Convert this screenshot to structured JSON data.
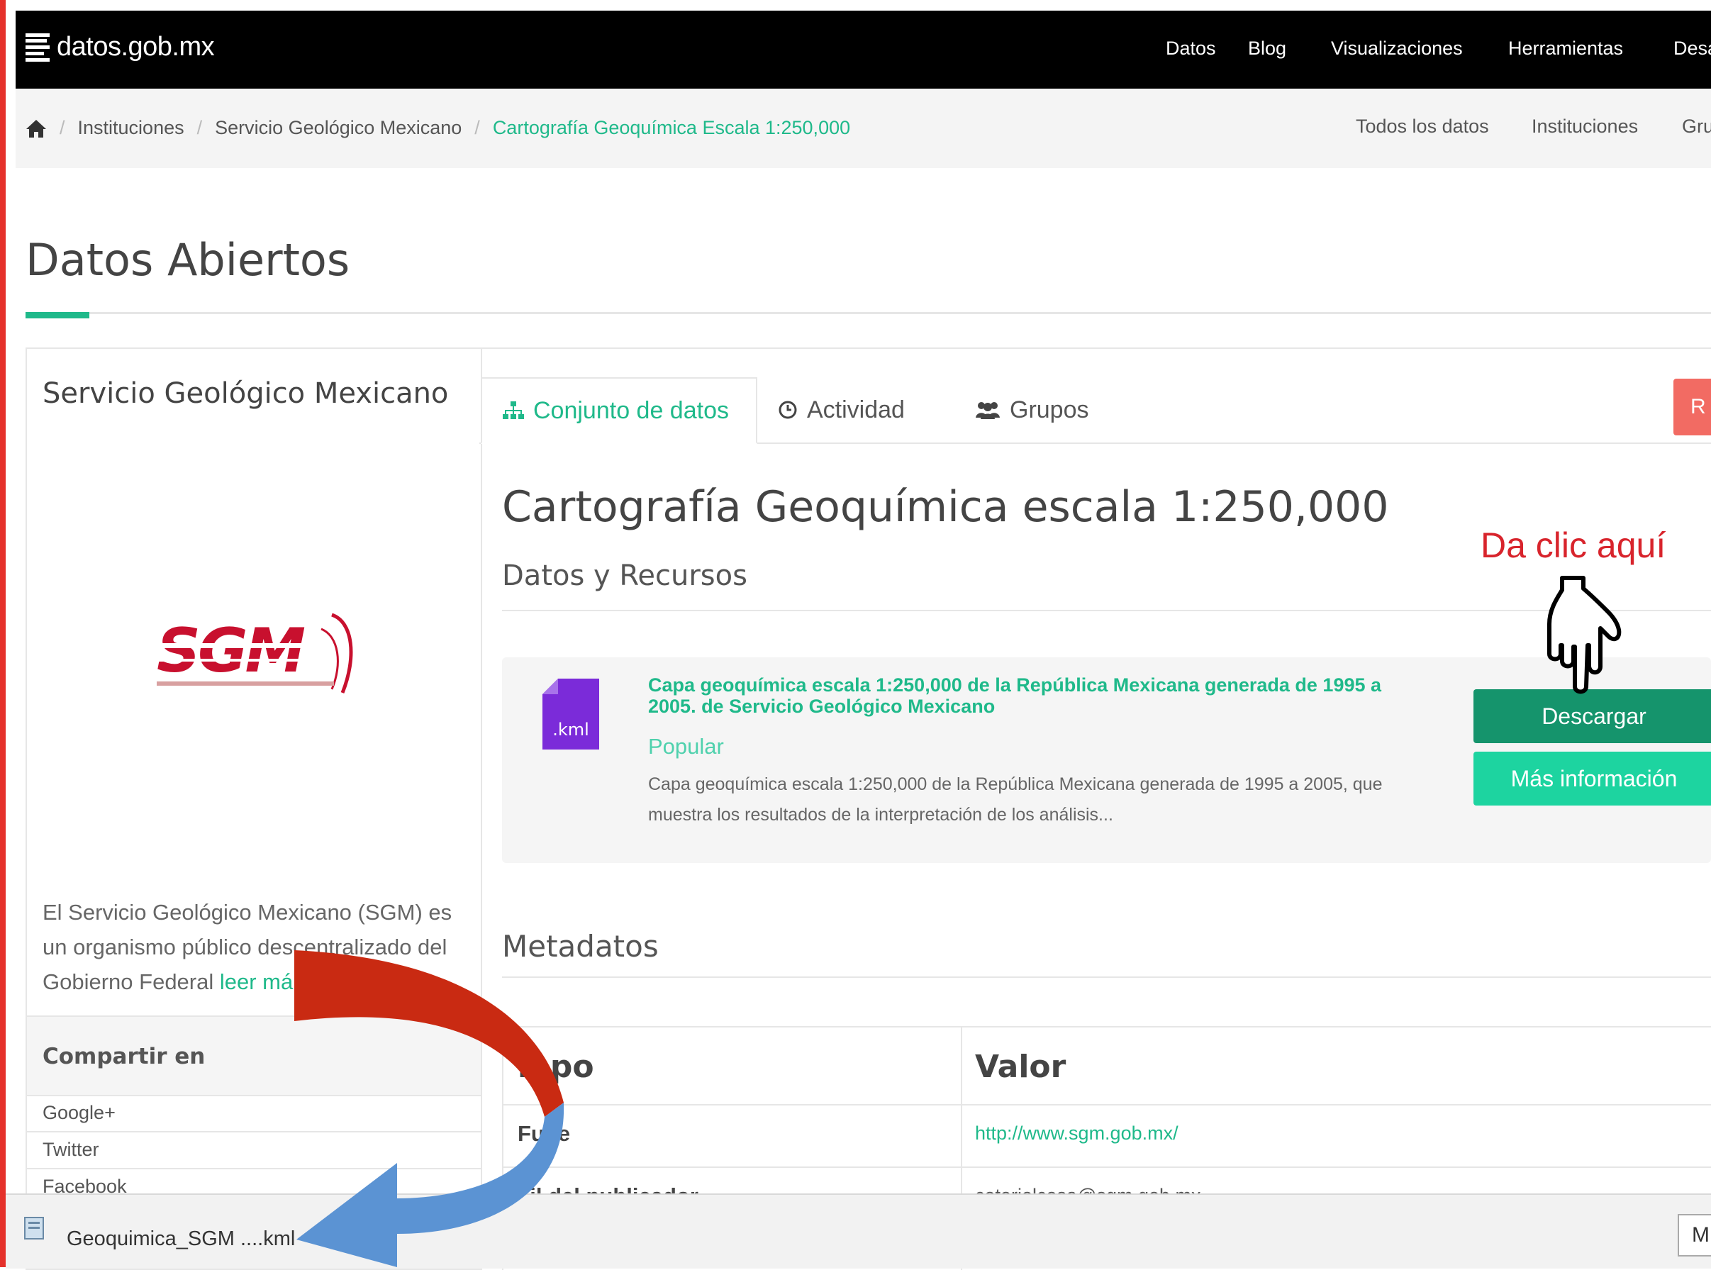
{
  "nav": {
    "brand": "datos.gob.mx",
    "links": [
      "Datos",
      "Blog",
      "Visualizaciones",
      "Herramientas",
      "Desa"
    ]
  },
  "breadcrumb": {
    "items": [
      "Instituciones",
      "Servicio Geológico Mexicano"
    ],
    "current": "Cartografía Geoquímica Escala 1:250,000",
    "sublinks": [
      "Todos los datos",
      "Instituciones",
      "Gru"
    ]
  },
  "page": {
    "title": "Datos Abiertos"
  },
  "sidebar": {
    "org_name": "Servicio Geológico Mexicano",
    "logo_text": "SGM",
    "description": "El Servicio Geológico Mexicano (SGM) es un organismo público descentralizado del Gobierno Federal",
    "read_more": "leer má",
    "share_title": "Compartir en",
    "share_items": [
      "Google+",
      "Twitter",
      "Facebook"
    ]
  },
  "tabs": [
    {
      "label": "Conjunto de datos",
      "icon": "sitemap-icon",
      "active": true
    },
    {
      "label": "Actividad",
      "icon": "clock-icon",
      "active": false
    },
    {
      "label": "Grupos",
      "icon": "users-icon",
      "active": false
    }
  ],
  "red_button": {
    "label": "R"
  },
  "dataset": {
    "title": "Cartografía Geoquímica escala 1:250,000",
    "section": "Datos y Recursos"
  },
  "resource": {
    "format": ".kml",
    "title": "Capa geoquímica escala 1:250,000 de la República Mexicana generada de 1995 a 2005. de Servicio Geológico Mexicano",
    "tag": "Popular",
    "description": "Capa geoquímica escala 1:250,000 de la República Mexicana generada de 1995 a 2005, que muestra los resultados de la interpretación de los análisis...",
    "download_label": "Descargar",
    "more_label": "Más información"
  },
  "annotation": {
    "text": "Da clic aquí",
    "color": "#d8242c"
  },
  "metadata": {
    "title": "Metadatos",
    "col_field": "mpo",
    "col_value": "Valor",
    "rows": [
      {
        "key": "Fu    te",
        "value": "http://www.sgm.gob.mx/"
      },
      {
        "key": "ail del publicador",
        "value": "cotoriolcosa@sgm.gob.mx"
      }
    ]
  },
  "download_bar": {
    "filename": "Geoquimica_SGM ....kml",
    "button": "M"
  },
  "colors": {
    "accent": "#1fb98a",
    "download_btn": "#15946c",
    "more_btn": "#1dd4a0",
    "red_arrow": "#c92a12",
    "blue_arrow": "#5b93d3"
  }
}
